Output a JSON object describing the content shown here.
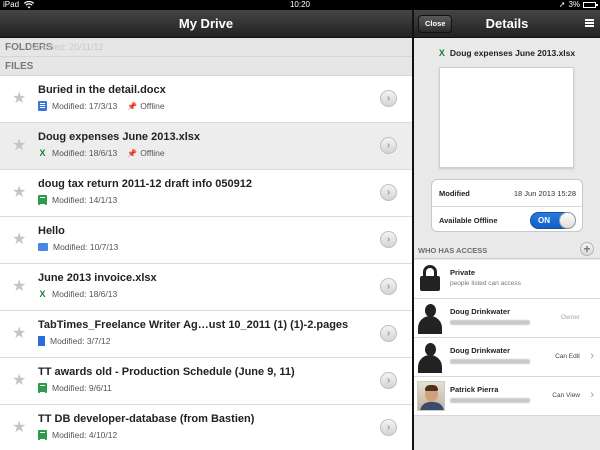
{
  "status_bar": {
    "carrier": "iPad",
    "time": "10:20",
    "battery": "3%"
  },
  "left_pane": {
    "title": "My Drive",
    "folders_header": "FOLDERS",
    "folders_ghost_text": "Modified: 20/11/12",
    "files_header": "FILES",
    "files": [
      {
        "name": "Buried in the detail.docx",
        "modified": "Modified: 17/3/13",
        "type_icon": "docx-icon",
        "offline": "Offline"
      },
      {
        "name": "Doug expenses June 2013.xlsx",
        "modified": "Modified: 18/6/13",
        "type_icon": "xlsx-icon",
        "offline": "Offline"
      },
      {
        "name": "doug tax return 2011-12 draft info 050912",
        "modified": "Modified: 14/1/13",
        "type_icon": "spreadsheet-icon",
        "offline": ""
      },
      {
        "name": "Hello",
        "modified": "Modified: 10/7/13",
        "type_icon": "presentation-icon",
        "offline": ""
      },
      {
        "name": "June 2013 invoice.xlsx",
        "modified": "Modified: 18/6/13",
        "type_icon": "xlsx-icon",
        "offline": ""
      },
      {
        "name": "TabTimes_Freelance Writer Ag…ust 10_2011 (1) (1)-2.pages",
        "modified": "Modified: 3/7/12",
        "type_icon": "pages-icon",
        "offline": ""
      },
      {
        "name": "TT awards old - Production Schedule (June 9, 11)",
        "modified": "Modified: 9/6/11",
        "type_icon": "spreadsheet-icon",
        "offline": ""
      },
      {
        "name": "TT DB developer-database (from Bastien)",
        "modified": "Modified: 4/10/12",
        "type_icon": "spreadsheet-icon",
        "offline": ""
      }
    ]
  },
  "details": {
    "title": "Details",
    "close_label": "Close",
    "file_name": "Doug expenses June 2013.xlsx",
    "file_type_glyph": "X",
    "modified_label": "Modified",
    "modified_value": "18 Jun 2013 15:28",
    "offline_label": "Available Offline",
    "offline_toggle": "ON",
    "access_header": "WHO HAS ACCESS",
    "access": [
      {
        "name": "Private",
        "sub": "people listed can access",
        "role": "",
        "avatar": "lock-icon"
      },
      {
        "name": "Doug Drinkwater",
        "sub": "",
        "role": "Owner",
        "avatar": "person-silhouette-icon"
      },
      {
        "name": "Doug Drinkwater",
        "sub": "",
        "role": "Can Edit",
        "avatar": "person-silhouette-icon"
      },
      {
        "name": "Patrick Pierra",
        "sub": "",
        "role": "Can View",
        "avatar": "profile-photo"
      }
    ]
  }
}
